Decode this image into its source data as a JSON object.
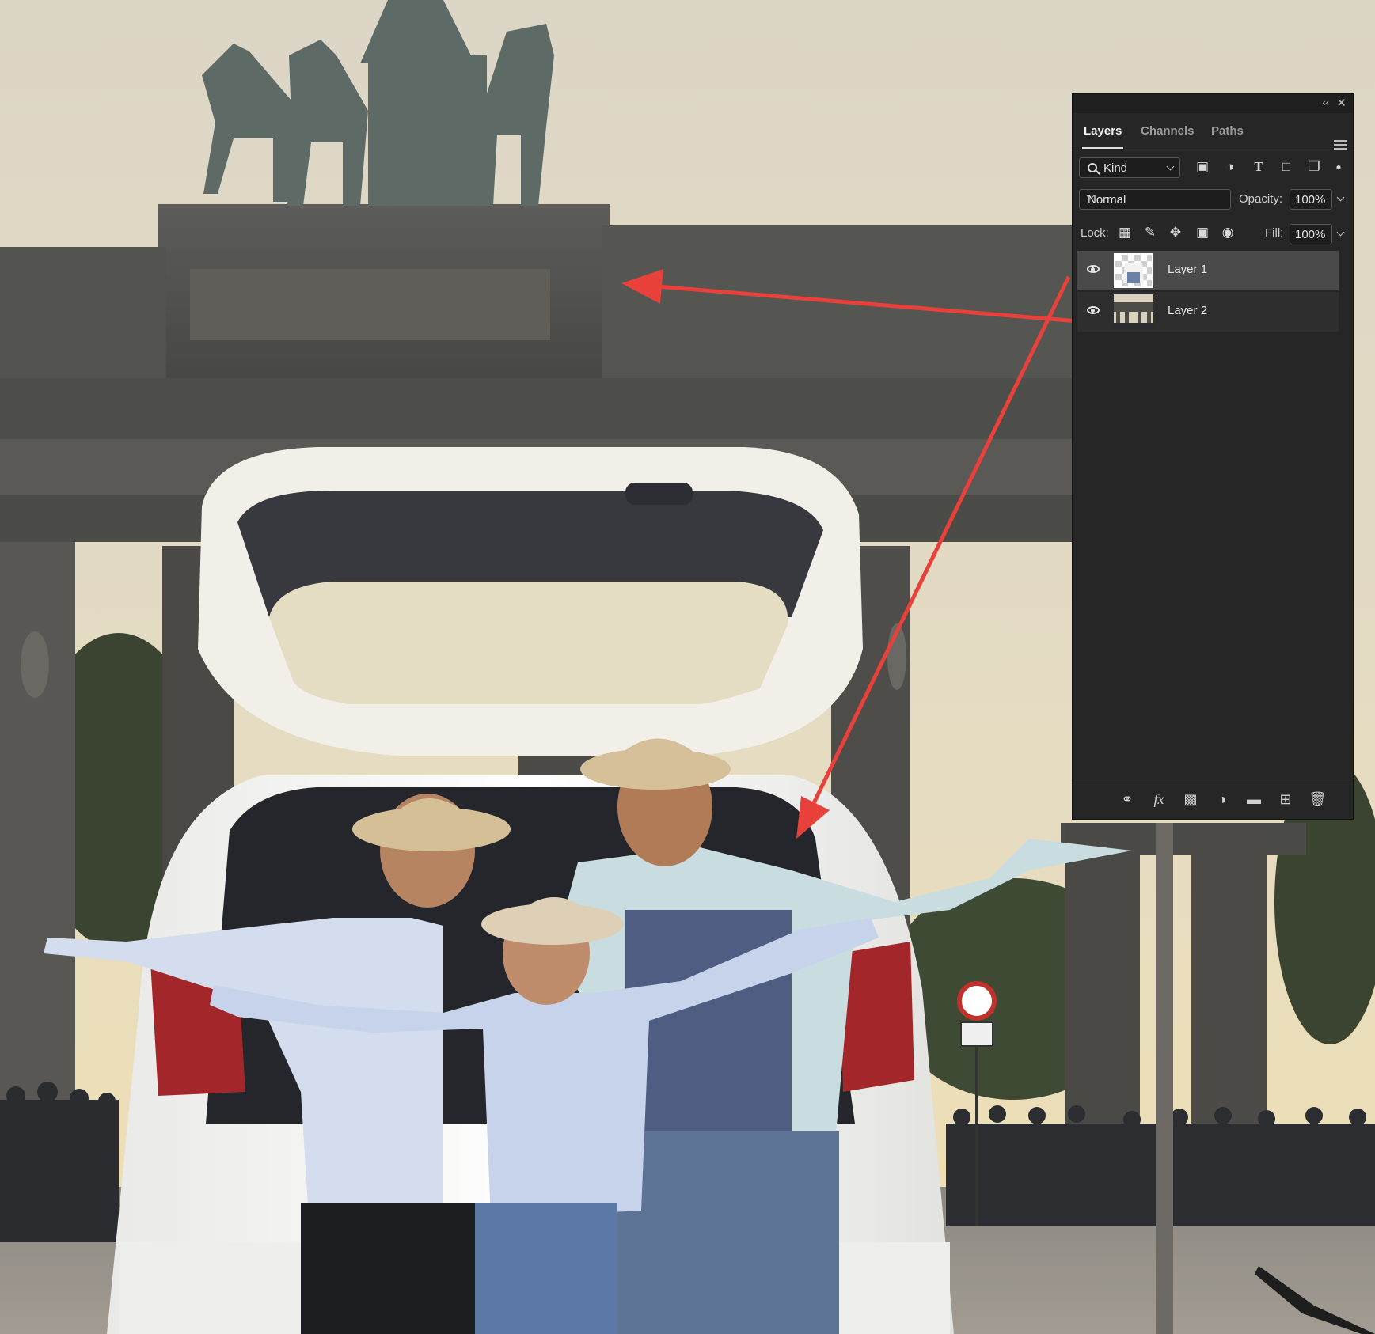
{
  "panel": {
    "tabs": [
      {
        "label": "Layers",
        "active": true
      },
      {
        "label": "Channels",
        "active": false
      },
      {
        "label": "Paths",
        "active": false
      }
    ],
    "collapse_glyph": "‹‹",
    "close_glyph": "✕",
    "filter": {
      "kind_label": "Kind",
      "icons": [
        "image-filter-icon",
        "adjustment-filter-icon",
        "type-filter-icon",
        "shape-filter-icon",
        "smart-object-filter-icon",
        "filter-toggle-icon"
      ]
    },
    "blend": {
      "mode": "Normal",
      "opacity_label": "Opacity:",
      "opacity_value": "100%"
    },
    "lock": {
      "label": "Lock:",
      "icons": [
        "lock-transparent-pixels-icon",
        "lock-image-pixels-icon",
        "lock-position-icon",
        "lock-artboard-icon",
        "lock-all-icon"
      ],
      "fill_label": "Fill:",
      "fill_value": "100%"
    },
    "layers": [
      {
        "name": "Layer 1",
        "visible": true,
        "selected": true
      },
      {
        "name": "Layer 2",
        "visible": true,
        "selected": false
      }
    ],
    "bottom_icons": [
      "link-layers-icon",
      "fx-icon",
      "layer-mask-icon",
      "adjustment-layer-icon",
      "group-folder-icon",
      "new-layer-icon",
      "trash-icon"
    ]
  },
  "colors": {
    "arrow": "#e8403a",
    "panel_bg": "#262626",
    "selected_layer": "#4a4a4a"
  }
}
